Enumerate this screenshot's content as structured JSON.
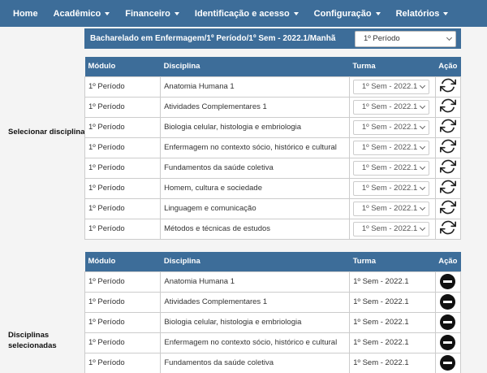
{
  "nav": {
    "items": [
      {
        "label": "Home",
        "dropdown": false
      },
      {
        "label": "Acadêmico",
        "dropdown": true
      },
      {
        "label": "Financeiro",
        "dropdown": true
      },
      {
        "label": "Identificação e acesso",
        "dropdown": true
      },
      {
        "label": "Configuração",
        "dropdown": true
      },
      {
        "label": "Relatórios",
        "dropdown": true
      }
    ]
  },
  "sections": {
    "select_label": "Selecionar disciplinas",
    "selected_label_line1": "Disciplinas",
    "selected_label_line2": "selecionadas"
  },
  "course": {
    "title": "Bacharelado em Enfermagem/1º Período/1º Sem - 2022.1/Manhã",
    "period_select": "1º Período"
  },
  "columns": {
    "modulo": "Módulo",
    "disciplina": "Disciplina",
    "turma": "Turma",
    "acao": "Ação"
  },
  "available": [
    {
      "modulo": "1º Período",
      "disciplina": "Anatomia Humana 1",
      "turma": "1º Sem - 2022.1"
    },
    {
      "modulo": "1º Período",
      "disciplina": "Atividades Complementares 1",
      "turma": "1º Sem - 2022.1"
    },
    {
      "modulo": "1º Período",
      "disciplina": "Biologia celular, histologia e embriologia",
      "turma": "1º Sem - 2022.1"
    },
    {
      "modulo": "1º Período",
      "disciplina": "Enfermagem no contexto sócio, histórico e cultural",
      "turma": "1º Sem - 2022.1"
    },
    {
      "modulo": "1º Período",
      "disciplina": "Fundamentos da saúde coletiva",
      "turma": "1º Sem - 2022.1"
    },
    {
      "modulo": "1º Período",
      "disciplina": "Homem, cultura e sociedade",
      "turma": "1º Sem - 2022.1"
    },
    {
      "modulo": "1º Período",
      "disciplina": "Linguagem e comunicação",
      "turma": "1º Sem - 2022.1"
    },
    {
      "modulo": "1º Período",
      "disciplina": "Métodos e técnicas de estudos",
      "turma": "1º Sem - 2022.1"
    }
  ],
  "selected": [
    {
      "modulo": "1º Período",
      "disciplina": "Anatomia Humana 1",
      "turma": "1º Sem - 2022.1"
    },
    {
      "modulo": "1º Período",
      "disciplina": "Atividades Complementares 1",
      "turma": "1º Sem - 2022.1"
    },
    {
      "modulo": "1º Período",
      "disciplina": "Biologia celular, histologia e embriologia",
      "turma": "1º Sem - 2022.1"
    },
    {
      "modulo": "1º Período",
      "disciplina": "Enfermagem no contexto sócio, histórico e cultural",
      "turma": "1º Sem - 2022.1"
    },
    {
      "modulo": "1º Período",
      "disciplina": "Fundamentos da saúde coletiva",
      "turma": "1º Sem - 2022.1"
    }
  ],
  "icons": {
    "swap": "sync-icon",
    "remove": "minus-circle-icon"
  },
  "colors": {
    "header": "#3d6d99",
    "background": "#f4f4f4"
  }
}
